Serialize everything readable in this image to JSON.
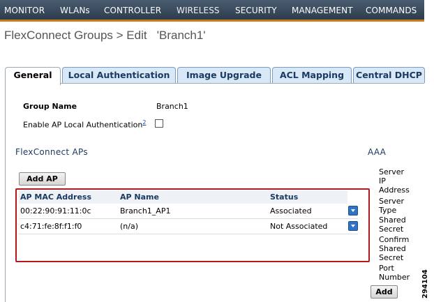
{
  "nav": {
    "items": [
      "MONITOR",
      "WLANs",
      "CONTROLLER",
      "WIRELESS",
      "SECURITY",
      "MANAGEMENT",
      "COMMANDS"
    ],
    "active": "WIRELESS"
  },
  "page": {
    "title": "FlexConnect Groups > Edit   'Branch1'"
  },
  "tabs": [
    {
      "label": "General",
      "active": true
    },
    {
      "label": "Local Authentication",
      "active": false
    },
    {
      "label": "Image Upgrade",
      "active": false
    },
    {
      "label": "ACL Mapping",
      "active": false
    },
    {
      "label": "Central DHCP",
      "active": false
    }
  ],
  "general": {
    "group_name_label": "Group Name",
    "group_name_value": "Branch1",
    "local_auth_label": "Enable AP Local Authentication",
    "local_auth_note": "2",
    "local_auth_checked": false
  },
  "flexconnect_aps": {
    "section_title": "FlexConnect APs",
    "add_button": "Add AP",
    "columns": [
      "AP MAC Address",
      "AP Name",
      "Status"
    ],
    "rows": [
      {
        "mac": "00:22:90:91:11:0c",
        "name": "Branch1_AP1",
        "status": "Associated"
      },
      {
        "mac": "c4:71:fe:8f:f1:f0",
        "name": "(n/a)",
        "status": "Not Associated"
      }
    ]
  },
  "aaa": {
    "section_title": "AAA",
    "fields": [
      [
        "Server",
        "IP",
        "Address"
      ],
      [
        "Server",
        "Type"
      ],
      [
        "Shared",
        "Secret"
      ],
      [
        "Confirm",
        "Shared",
        "Secret"
      ],
      [
        "Port",
        "Number"
      ]
    ],
    "add_button": "Add"
  },
  "figure_number": "294104",
  "colors": {
    "nav_bg": "#2c3c4d",
    "accent": "#cc7a1a",
    "highlight": "#b01a1a",
    "tab_bg": "#d8e8f6"
  }
}
